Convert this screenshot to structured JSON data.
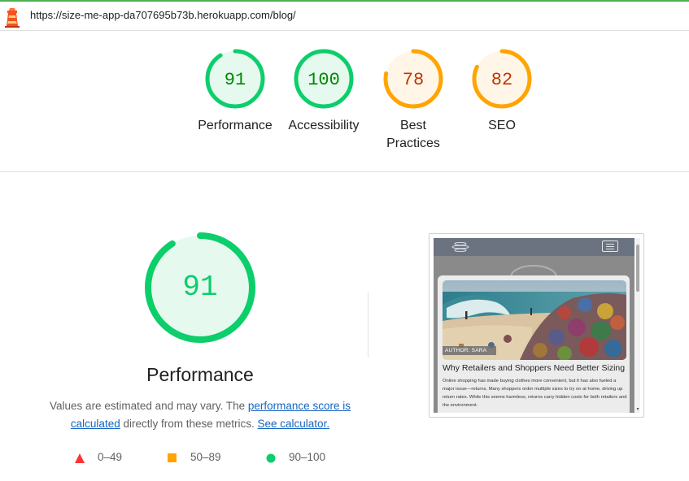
{
  "url": "https://size-me-app-da707695b73b.herokuapp.com/blog/",
  "colors": {
    "pass": "#0cce6b",
    "pass_fill": "#e6f9ee",
    "pass_text": "#008800",
    "average": "#ffa400",
    "average_fill": "#fff6e8",
    "average_text": "#c33300",
    "fail": "#ff3333",
    "link": "#1565c0"
  },
  "summary_gauges": [
    {
      "label": "Performance",
      "score": 91
    },
    {
      "label": "Accessibility",
      "score": 100
    },
    {
      "label": "Best Practices",
      "score": 78
    },
    {
      "label": "SEO",
      "score": 82
    }
  ],
  "performance": {
    "score": 91,
    "title": "Performance",
    "desc_prefix": "Values are estimated and may vary. The ",
    "link_score": "performance score is calculated",
    "desc_middle": " directly from these metrics. ",
    "link_calculator": "See calculator."
  },
  "legend": [
    {
      "range": "0–49",
      "shape": "triangle"
    },
    {
      "range": "50–89",
      "shape": "square"
    },
    {
      "range": "90–100",
      "shape": "circle"
    }
  ],
  "thumbnail": {
    "author": "AUTHOR: SARA",
    "title": "Why Retailers and Shoppers Need Better Sizing",
    "body": "Online shopping has made buying clothes more convenient, but it has also fueled a major issue—returns. Many shoppers order multiple sizes to try on at home, driving up return rates. While this seems harmless, returns carry hidden costs for both retailers and the environment."
  }
}
